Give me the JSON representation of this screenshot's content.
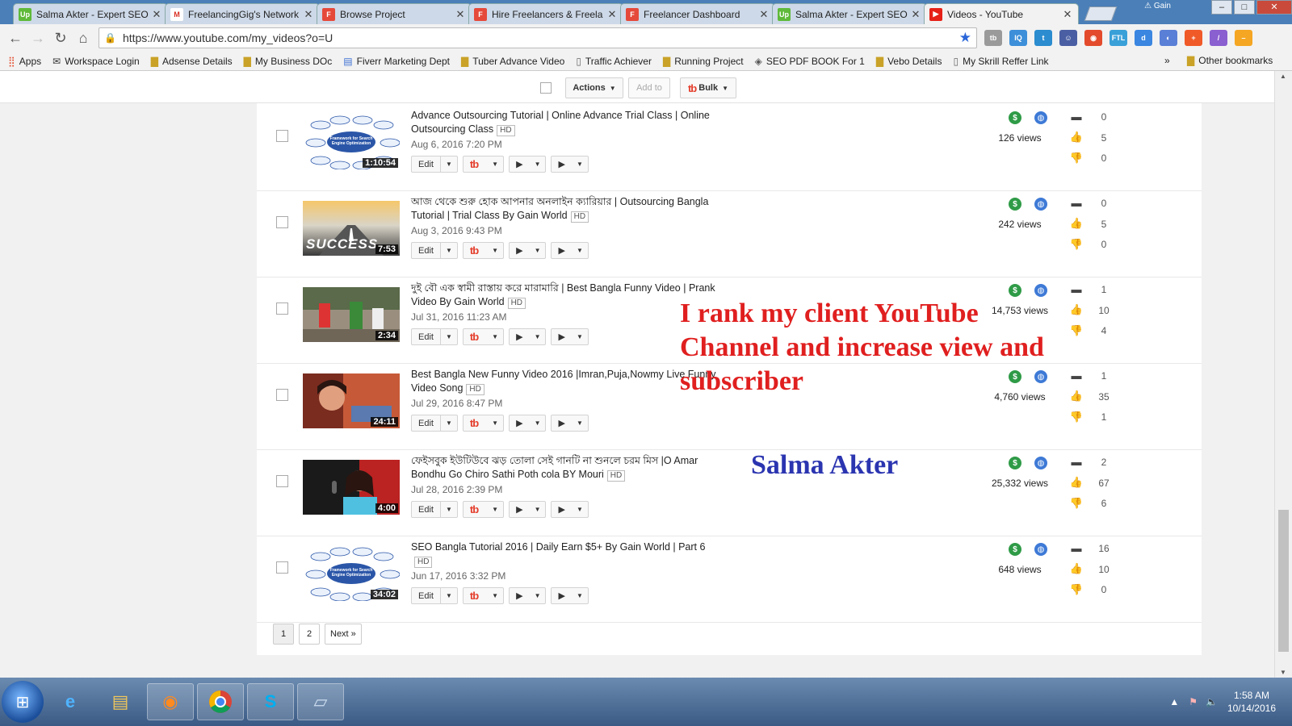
{
  "tabs": [
    {
      "title": "Salma Akter - Expert SEO",
      "icon": "upwork-icon",
      "color": "#5fba3a",
      "glyph": "Up"
    },
    {
      "title": "FreelancingGig's Network",
      "icon": "gmail-icon",
      "color": "#ffffff",
      "glyph": "M"
    },
    {
      "title": "Browse Project",
      "icon": "freelancer-icon",
      "color": "#e5493a",
      "glyph": "F"
    },
    {
      "title": "Hire Freelancers & Freela",
      "icon": "freelancer-icon",
      "color": "#e5493a",
      "glyph": "F"
    },
    {
      "title": "Freelancer Dashboard",
      "icon": "freelancer-icon",
      "color": "#e5493a",
      "glyph": "F"
    },
    {
      "title": "Salma Akter - Expert SEO",
      "icon": "upwork-icon",
      "color": "#5fba3a",
      "glyph": "Up"
    },
    {
      "title": "Videos - YouTube",
      "icon": "youtube-icon",
      "color": "#e62117",
      "glyph": "▶"
    }
  ],
  "window": {
    "badge": "Gain"
  },
  "url": "https://www.youtube.com/my_videos?o=U",
  "extensions": [
    {
      "name": "tubebuddy-ext-icon",
      "color": "#9a9a9a",
      "glyph": "tb"
    },
    {
      "name": "iq-ext-icon",
      "color": "#3d8fd9",
      "glyph": "IQ"
    },
    {
      "name": "twitter-ext-icon",
      "color": "#2b8ccf",
      "glyph": "t"
    },
    {
      "name": "ext-icon",
      "color": "#4a5fa3",
      "glyph": "☺"
    },
    {
      "name": "ext-icon",
      "color": "#e34b2c",
      "glyph": "◉"
    },
    {
      "name": "ftl-ext-icon",
      "color": "#3aa0d8",
      "glyph": "FTL"
    },
    {
      "name": "ext-icon",
      "color": "#3a86e0",
      "glyph": "d"
    },
    {
      "name": "ext-icon",
      "color": "#5a7fd6",
      "glyph": "◐"
    },
    {
      "name": "ext-icon",
      "color": "#f05a28",
      "glyph": "+"
    },
    {
      "name": "ext-icon",
      "color": "#8a5fd0",
      "glyph": "/"
    },
    {
      "name": "ext-icon",
      "color": "#f5a623",
      "glyph": "–"
    }
  ],
  "bookmarks": [
    {
      "label": "Apps",
      "icon": "apps-grid-icon"
    },
    {
      "label": "Workspace Login",
      "icon": "envelope-icon"
    },
    {
      "label": "Adsense Details",
      "icon": "folder-icon"
    },
    {
      "label": "My Business DOc",
      "icon": "folder-icon"
    },
    {
      "label": "Fiverr Marketing Dept",
      "icon": "doc-icon"
    },
    {
      "label": "Tuber Advance Video",
      "icon": "folder-icon"
    },
    {
      "label": "Traffic Achiever",
      "icon": "page-icon"
    },
    {
      "label": "Running Project",
      "icon": "folder-icon"
    },
    {
      "label": "SEO PDF BOOK  For 1",
      "icon": "diamond-icon"
    },
    {
      "label": "Vebo Details",
      "icon": "folder-icon"
    },
    {
      "label": "My Skrill Reffer Link",
      "icon": "page-icon"
    }
  ],
  "bookmarks_more": "»",
  "bookmarks_other": "Other bookmarks",
  "actionbar": {
    "actions": "Actions",
    "add_to": "Add to",
    "bulk": "Bulk"
  },
  "videos": [
    {
      "title": "Advance Outsourcing Tutorial | Online Advance Trial Class | Online Outsourcing Class",
      "hd": "HD",
      "date": "Aug 6, 2016 7:20 PM",
      "duration": "1:10:54",
      "views": "126 views",
      "comments": "0",
      "likes": "5",
      "dislikes": "0",
      "thumb": "diagram"
    },
    {
      "title": "আজ থেকে শুরু হোক আপনার অনলাইন ক্যারিয়ার | Outsourcing Bangla Tutorial | Trial Class By Gain World",
      "hd": "HD",
      "date": "Aug 3, 2016 9:43 PM",
      "duration": "7:53",
      "views": "242 views",
      "comments": "0",
      "likes": "5",
      "dislikes": "0",
      "thumb": "success",
      "thumb_text": "SUCCESS"
    },
    {
      "title": "দুই বৌ এক স্বামী রাস্তায় করে মারামারি | Best Bangla Funny Video | Prank Video By Gain World",
      "hd": "HD",
      "date": "Jul 31, 2016 11:23 AM",
      "duration": "2:34",
      "views": "14,753 views",
      "comments": "1",
      "likes": "10",
      "dislikes": "4",
      "thumb": "street"
    },
    {
      "title": "Best Bangla New Funny Video 2016 |Imran,Puja,Nowmy Live Funny Video Song",
      "hd": "HD",
      "date": "Jul 29, 2016 8:47 PM",
      "duration": "24:11",
      "views": "4,760 views",
      "comments": "1",
      "likes": "35",
      "dislikes": "1",
      "thumb": "selfie"
    },
    {
      "title": "ফেইসবুক ইউটিউবে ঝড় তোলা সেই গানটি না শুনলে চরম মিস |O Amar Bondhu Go Chiro Sathi Poth cola BY Mouri",
      "hd": "HD",
      "date": "Jul 28, 2016 2:39 PM",
      "duration": "4:00",
      "views": "25,332 views",
      "comments": "2",
      "likes": "67",
      "dislikes": "6",
      "thumb": "singer"
    },
    {
      "title": "SEO Bangla Tutorial 2016 | Daily Earn $5+ By Gain World | Part 6",
      "hd": "HD",
      "date": "Jun 17, 2016 3:32 PM",
      "duration": "34:02",
      "views": "648 views",
      "comments": "16",
      "likes": "10",
      "dislikes": "0",
      "thumb": "diagram"
    }
  ],
  "diagram_thumb": {
    "center": "Framework for Search Engine Optimization"
  },
  "row_buttons": {
    "edit": "Edit"
  },
  "pager": [
    "1",
    "2",
    "Next »"
  ],
  "overlay": {
    "headline": "I rank my client YouTube Channel and increase view and subscriber",
    "author": "Salma Akter"
  },
  "taskbar": {
    "time": "1:58 AM",
    "date": "10/14/2016"
  }
}
